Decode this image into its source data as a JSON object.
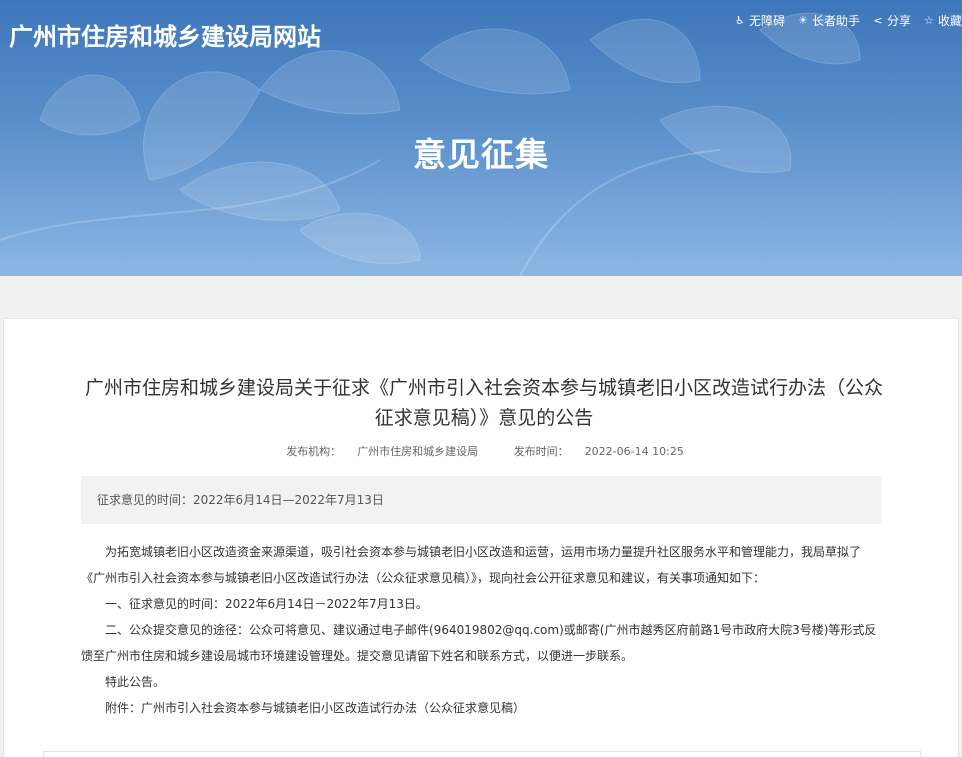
{
  "site": {
    "title": "广州市住房和城乡建设局网站",
    "tools": [
      {
        "icon": "accessibility-icon",
        "label": "无障碍"
      },
      {
        "icon": "elderly-icon",
        "label": "长者助手"
      },
      {
        "icon": "share-icon",
        "label": "分享"
      },
      {
        "icon": "star-icon",
        "label": "收藏"
      }
    ]
  },
  "banner": {
    "heading": "意见征集"
  },
  "article": {
    "title": "广州市住房和城乡建设局关于征求《广州市引入社会资本参与城镇老旧小区改造试行办法（公众征求意见稿）》意见的公告",
    "publisher_label": "发布机构：",
    "publisher": "广州市住房和城乡建设局",
    "time_label": "发布时间：",
    "time": "2022-06-14 10:25",
    "period_label": "征求意见的时间：",
    "period": "2022年6月14日—2022年7月13日",
    "paragraphs": [
      "为拓宽城镇老旧小区改造资金来源渠道，吸引社会资本参与城镇老旧小区改造和运营，运用市场力量提升社区服务水平和管理能力，我局草拟了《广州市引入社会资本参与城镇老旧小区改造试行办法（公众征求意见稿）》，现向社会公开征求意见和建议，有关事项通知如下：",
      "一、征求意见的时间：2022年6月14日－2022年7月13日。",
      "二、公众提交意见的途径：公众可将意见、建议通过电子邮件(964019802@qq.com)或邮寄(广州市越秀区府前路1号市政府大院3号楼)等形式反馈至广州市住房和城乡建设局城市环境建设管理处。提交意见请留下姓名和联系方式，以便进一步联系。",
      "特此公告。",
      "附件：广州市引入社会资本参与城镇老旧小区改造试行办法（公众征求意见稿）"
    ]
  },
  "colors": {
    "banner_top": "#3d76ba",
    "banner_bottom": "#8db6e3",
    "text": "#333333",
    "background": "#f1f1f1"
  }
}
